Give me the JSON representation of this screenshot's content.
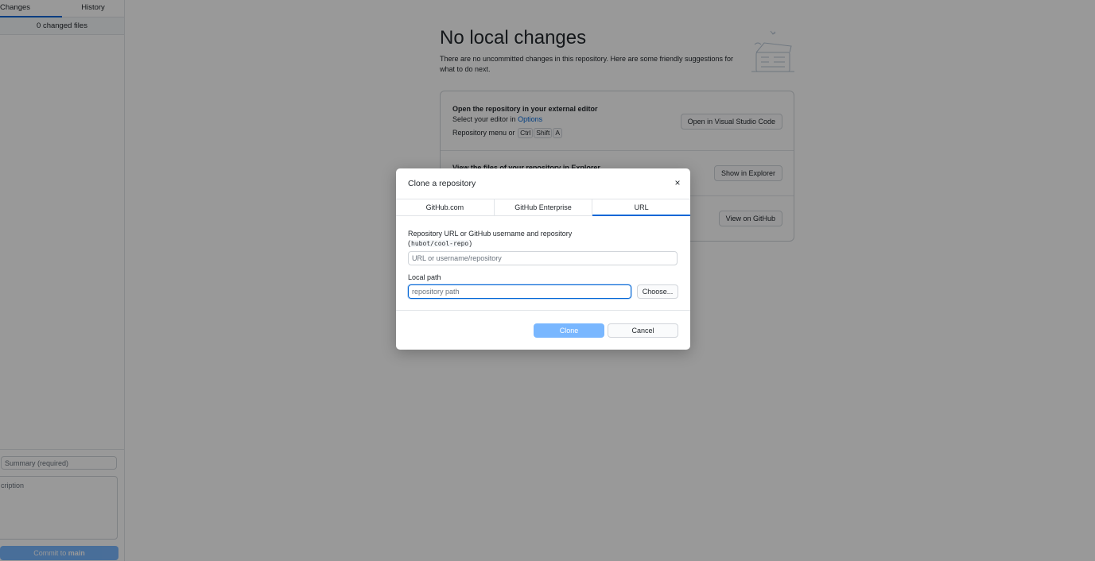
{
  "sidebar": {
    "tabs": [
      {
        "label": "Changes",
        "active": true
      },
      {
        "label": "History",
        "active": false
      }
    ],
    "changed_files": "0 changed files",
    "summary_placeholder": "Summary (required)",
    "description_placeholder": "cription",
    "commit_prefix": "Commit to",
    "commit_branch": "main"
  },
  "main": {
    "title": "No local changes",
    "subtitle": "There are no uncommitted changes in this repository. Here are some friendly suggestions for what to do next.",
    "suggestions": {
      "editor": {
        "title": "Open the repository in your external editor",
        "line1_prefix": "Select your editor in",
        "line1_link": "Options",
        "line2_prefix": "Repository menu or",
        "keys": [
          "Ctrl",
          "Shift",
          "A"
        ],
        "button": "Open in Visual Studio Code"
      },
      "explorer": {
        "title": "View the files of your repository in Explorer",
        "button": "Show in Explorer"
      },
      "github": {
        "button": "View on GitHub"
      }
    }
  },
  "dialog": {
    "title": "Clone a repository",
    "close_glyph": "×",
    "tabs": [
      {
        "label": "GitHub.com",
        "active": false
      },
      {
        "label": "GitHub Enterprise",
        "active": false
      },
      {
        "label": "URL",
        "active": true
      }
    ],
    "url_label": "Repository URL or GitHub username and repository",
    "url_example": "hubot/cool-repo",
    "url_placeholder": "URL or username/repository",
    "path_label": "Local path",
    "path_placeholder": "repository path",
    "choose_button": "Choose...",
    "clone_button": "Clone",
    "cancel_button": "Cancel"
  },
  "colors": {
    "accent": "#0366d6",
    "primary_button": "#2188ff",
    "overlay": "rgba(0,0,0,0.4)"
  }
}
